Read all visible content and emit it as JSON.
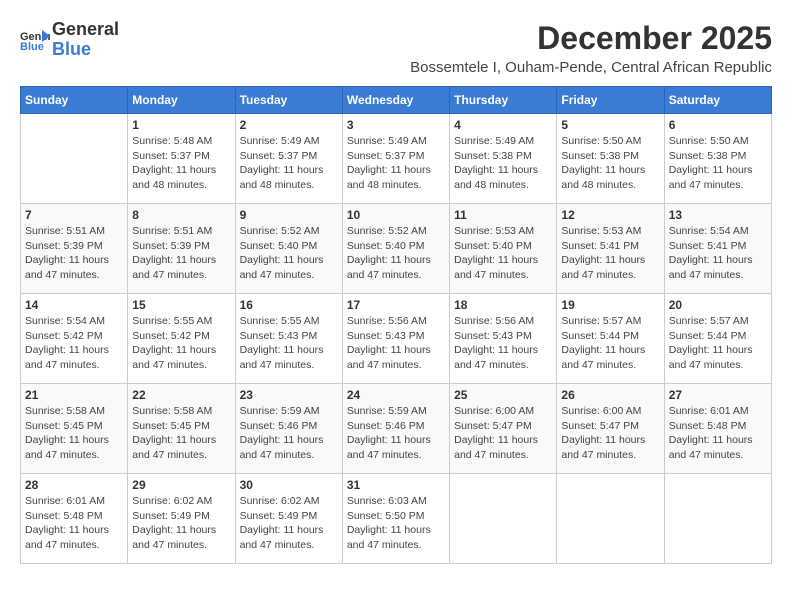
{
  "logo": {
    "line1": "General",
    "line2": "Blue"
  },
  "header": {
    "month_title": "December 2025",
    "subtitle": "Bossemtele I, Ouham-Pende, Central African Republic"
  },
  "weekdays": [
    "Sunday",
    "Monday",
    "Tuesday",
    "Wednesday",
    "Thursday",
    "Friday",
    "Saturday"
  ],
  "weeks": [
    [
      {
        "day": "",
        "info": ""
      },
      {
        "day": "1",
        "info": "Sunrise: 5:48 AM\nSunset: 5:37 PM\nDaylight: 11 hours\nand 48 minutes."
      },
      {
        "day": "2",
        "info": "Sunrise: 5:49 AM\nSunset: 5:37 PM\nDaylight: 11 hours\nand 48 minutes."
      },
      {
        "day": "3",
        "info": "Sunrise: 5:49 AM\nSunset: 5:37 PM\nDaylight: 11 hours\nand 48 minutes."
      },
      {
        "day": "4",
        "info": "Sunrise: 5:49 AM\nSunset: 5:38 PM\nDaylight: 11 hours\nand 48 minutes."
      },
      {
        "day": "5",
        "info": "Sunrise: 5:50 AM\nSunset: 5:38 PM\nDaylight: 11 hours\nand 48 minutes."
      },
      {
        "day": "6",
        "info": "Sunrise: 5:50 AM\nSunset: 5:38 PM\nDaylight: 11 hours\nand 47 minutes."
      }
    ],
    [
      {
        "day": "7",
        "info": "Sunrise: 5:51 AM\nSunset: 5:39 PM\nDaylight: 11 hours\nand 47 minutes."
      },
      {
        "day": "8",
        "info": "Sunrise: 5:51 AM\nSunset: 5:39 PM\nDaylight: 11 hours\nand 47 minutes."
      },
      {
        "day": "9",
        "info": "Sunrise: 5:52 AM\nSunset: 5:40 PM\nDaylight: 11 hours\nand 47 minutes."
      },
      {
        "day": "10",
        "info": "Sunrise: 5:52 AM\nSunset: 5:40 PM\nDaylight: 11 hours\nand 47 minutes."
      },
      {
        "day": "11",
        "info": "Sunrise: 5:53 AM\nSunset: 5:40 PM\nDaylight: 11 hours\nand 47 minutes."
      },
      {
        "day": "12",
        "info": "Sunrise: 5:53 AM\nSunset: 5:41 PM\nDaylight: 11 hours\nand 47 minutes."
      },
      {
        "day": "13",
        "info": "Sunrise: 5:54 AM\nSunset: 5:41 PM\nDaylight: 11 hours\nand 47 minutes."
      }
    ],
    [
      {
        "day": "14",
        "info": "Sunrise: 5:54 AM\nSunset: 5:42 PM\nDaylight: 11 hours\nand 47 minutes."
      },
      {
        "day": "15",
        "info": "Sunrise: 5:55 AM\nSunset: 5:42 PM\nDaylight: 11 hours\nand 47 minutes."
      },
      {
        "day": "16",
        "info": "Sunrise: 5:55 AM\nSunset: 5:43 PM\nDaylight: 11 hours\nand 47 minutes."
      },
      {
        "day": "17",
        "info": "Sunrise: 5:56 AM\nSunset: 5:43 PM\nDaylight: 11 hours\nand 47 minutes."
      },
      {
        "day": "18",
        "info": "Sunrise: 5:56 AM\nSunset: 5:43 PM\nDaylight: 11 hours\nand 47 minutes."
      },
      {
        "day": "19",
        "info": "Sunrise: 5:57 AM\nSunset: 5:44 PM\nDaylight: 11 hours\nand 47 minutes."
      },
      {
        "day": "20",
        "info": "Sunrise: 5:57 AM\nSunset: 5:44 PM\nDaylight: 11 hours\nand 47 minutes."
      }
    ],
    [
      {
        "day": "21",
        "info": "Sunrise: 5:58 AM\nSunset: 5:45 PM\nDaylight: 11 hours\nand 47 minutes."
      },
      {
        "day": "22",
        "info": "Sunrise: 5:58 AM\nSunset: 5:45 PM\nDaylight: 11 hours\nand 47 minutes."
      },
      {
        "day": "23",
        "info": "Sunrise: 5:59 AM\nSunset: 5:46 PM\nDaylight: 11 hours\nand 47 minutes."
      },
      {
        "day": "24",
        "info": "Sunrise: 5:59 AM\nSunset: 5:46 PM\nDaylight: 11 hours\nand 47 minutes."
      },
      {
        "day": "25",
        "info": "Sunrise: 6:00 AM\nSunset: 5:47 PM\nDaylight: 11 hours\nand 47 minutes."
      },
      {
        "day": "26",
        "info": "Sunrise: 6:00 AM\nSunset: 5:47 PM\nDaylight: 11 hours\nand 47 minutes."
      },
      {
        "day": "27",
        "info": "Sunrise: 6:01 AM\nSunset: 5:48 PM\nDaylight: 11 hours\nand 47 minutes."
      }
    ],
    [
      {
        "day": "28",
        "info": "Sunrise: 6:01 AM\nSunset: 5:48 PM\nDaylight: 11 hours\nand 47 minutes."
      },
      {
        "day": "29",
        "info": "Sunrise: 6:02 AM\nSunset: 5:49 PM\nDaylight: 11 hours\nand 47 minutes."
      },
      {
        "day": "30",
        "info": "Sunrise: 6:02 AM\nSunset: 5:49 PM\nDaylight: 11 hours\nand 47 minutes."
      },
      {
        "day": "31",
        "info": "Sunrise: 6:03 AM\nSunset: 5:50 PM\nDaylight: 11 hours\nand 47 minutes."
      },
      {
        "day": "",
        "info": ""
      },
      {
        "day": "",
        "info": ""
      },
      {
        "day": "",
        "info": ""
      }
    ]
  ]
}
